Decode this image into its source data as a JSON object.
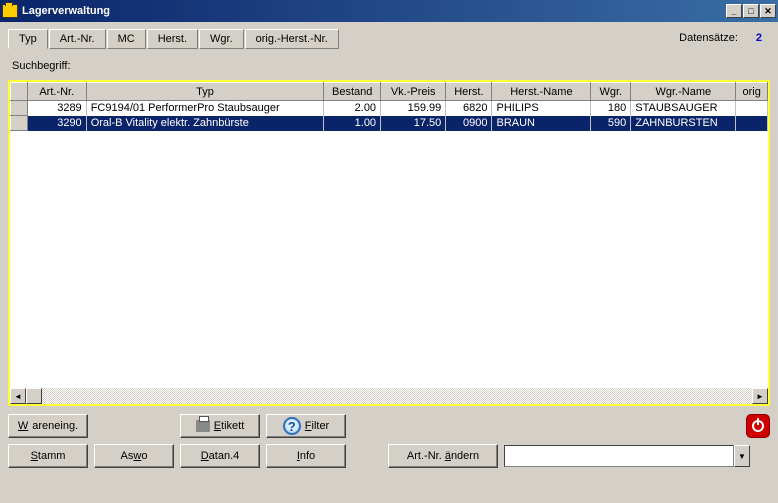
{
  "window": {
    "title": "Lagerverwaltung"
  },
  "records": {
    "label": "Datensätze:",
    "count": "2"
  },
  "tabs": [
    "Typ",
    "Art.-Nr.",
    "MC",
    "Herst.",
    "Wgr.",
    "orig.-Herst.-Nr."
  ],
  "active_tab": 0,
  "search": {
    "label": "Suchbegriff:"
  },
  "grid": {
    "columns": [
      "Art.-Nr.",
      "Typ",
      "Bestand",
      "Vk.-Preis",
      "Herst.",
      "Herst.-Name",
      "Wgr.",
      "Wgr.-Name",
      "orig"
    ],
    "rows": [
      {
        "art_nr": "3289",
        "typ": "FC9194/01 PerformerPro Staubsauger",
        "bestand": "2.00",
        "vk_preis": "159.99",
        "herst": "6820",
        "herst_name": "PHILIPS",
        "wgr": "180",
        "wgr_name": "STAUBSAUGER",
        "selected": false
      },
      {
        "art_nr": "3290",
        "typ": "Oral-B Vitality elektr. Zahnbürste",
        "bestand": "1.00",
        "vk_preis": "17.50",
        "herst": "0900",
        "herst_name": "BRAUN",
        "wgr": "590",
        "wgr_name": "ZAHNBURSTEN",
        "selected": true
      }
    ]
  },
  "buttons": {
    "wareneing": "Wareneing.",
    "etikett": "Etikett",
    "filter": "Filter",
    "stamm": "Stamm",
    "aswo": "Aswo",
    "datan4": "Datan.4",
    "info": "Info",
    "artnr_aendern": "Art.-Nr. ändern"
  }
}
